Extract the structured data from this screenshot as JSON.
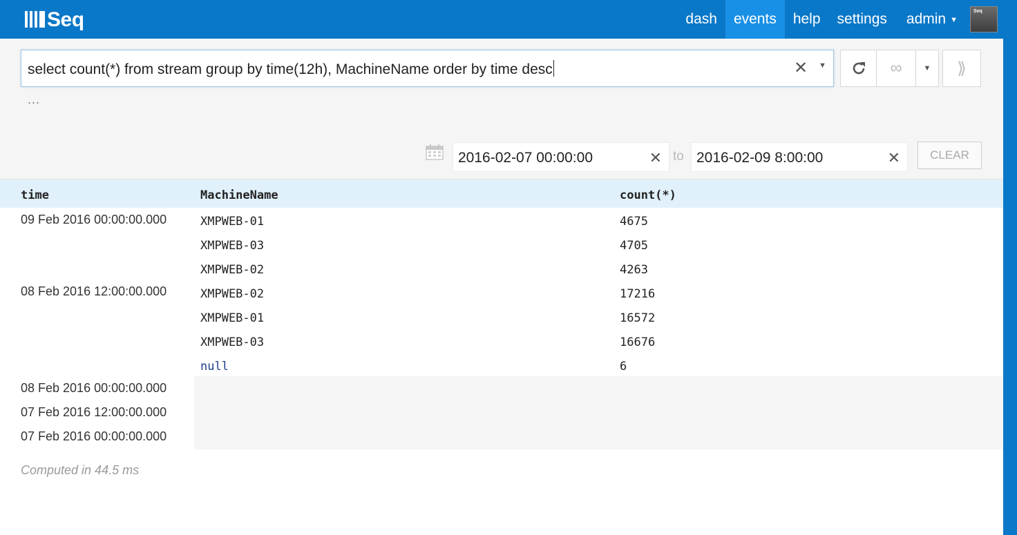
{
  "app": {
    "logo_text": "Seq"
  },
  "nav": {
    "items": [
      {
        "label": "dash",
        "active": false
      },
      {
        "label": "events",
        "active": true
      },
      {
        "label": "help",
        "active": false
      },
      {
        "label": "settings",
        "active": false
      }
    ],
    "user": "admin",
    "avatar_text": "Seq"
  },
  "query": {
    "text": "select count(*) from stream group by time(12h), MachineName order by time desc",
    "ellipsis": "..."
  },
  "range": {
    "from": "2016-02-07 00:00:00",
    "to_label": "to",
    "to": "2016-02-09 8:00:00",
    "clear_label": "CLEAR"
  },
  "table": {
    "columns": [
      "time",
      "MachineName",
      "count(*)"
    ],
    "groups": [
      {
        "time": "09 Feb 2016 00:00:00.000",
        "rows": [
          {
            "machine": "XMPWEB-01",
            "count": "4675"
          },
          {
            "machine": "XMPWEB-03",
            "count": "4705"
          },
          {
            "machine": "XMPWEB-02",
            "count": "4263"
          }
        ]
      },
      {
        "time": "08 Feb 2016 12:00:00.000",
        "rows": [
          {
            "machine": "XMPWEB-02",
            "count": "17216"
          },
          {
            "machine": "XMPWEB-01",
            "count": "16572"
          },
          {
            "machine": "XMPWEB-03",
            "count": "16676"
          },
          {
            "machine": "null",
            "count": "6"
          }
        ]
      }
    ],
    "empty_times": [
      "08 Feb 2016 00:00:00.000",
      "07 Feb 2016 12:00:00.000",
      "07 Feb 2016 00:00:00.000"
    ]
  },
  "footer": {
    "computed": "Computed in 44.5 ms"
  },
  "colors": {
    "accent": "#0a78c8",
    "active_tab": "#1890e6",
    "header_row": "#e1f1fb",
    "null_value": "#1f3f86"
  }
}
